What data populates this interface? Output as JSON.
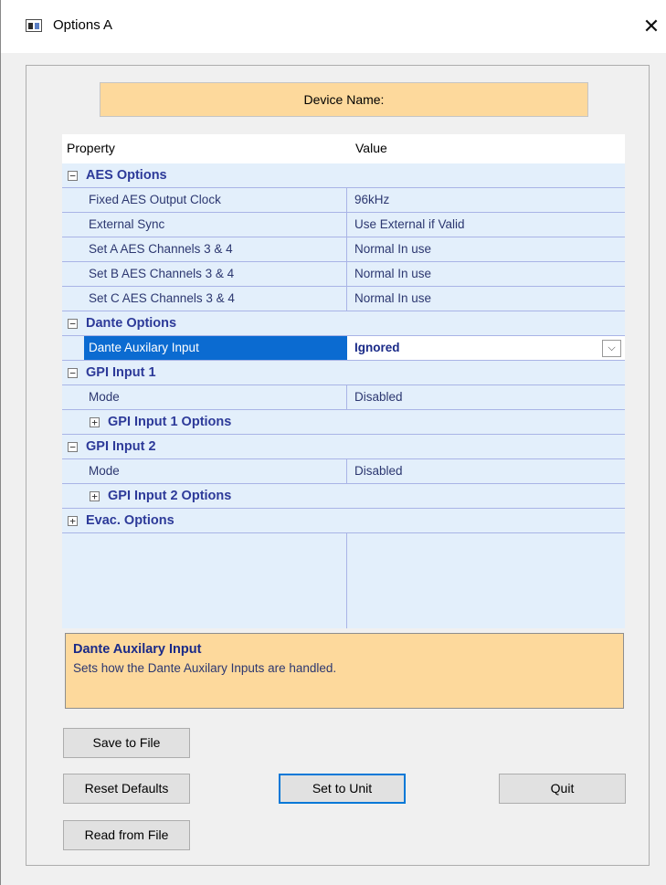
{
  "window": {
    "title": "Options A",
    "close_glyph": "✕"
  },
  "device": {
    "label": "Device Name:"
  },
  "grid": {
    "headers": {
      "property": "Property",
      "value": "Value"
    },
    "aes": {
      "category": "AES Options",
      "rows": [
        {
          "name": "Fixed AES Output Clock",
          "value": "96kHz"
        },
        {
          "name": "External Sync",
          "value": "Use External if Valid"
        },
        {
          "name": "Set A AES Channels 3 & 4",
          "value": "Normal In use"
        },
        {
          "name": "Set B AES Channels 3 & 4",
          "value": "Normal In use"
        },
        {
          "name": "Set C AES Channels 3 & 4",
          "value": "Normal In use"
        }
      ]
    },
    "dante": {
      "category": "Dante Options",
      "selected_row": {
        "name": "Dante Auxilary Input",
        "value": "Ignored"
      }
    },
    "gpi1": {
      "category": "GPI Input 1",
      "mode_name": "Mode",
      "mode_value": "Disabled",
      "sub": "GPI Input 1 Options"
    },
    "gpi2": {
      "category": "GPI Input 2",
      "mode_name": "Mode",
      "mode_value": "Disabled",
      "sub": "GPI Input 2 Options"
    },
    "evac": {
      "category": "Evac. Options"
    },
    "expander": {
      "collapse": "−",
      "expand": "+"
    },
    "dropdown_glyph": "⌵"
  },
  "help": {
    "title": "Dante Auxilary Input",
    "description": "Sets how the Dante Auxilary Inputs are handled."
  },
  "buttons": {
    "save": "Save to File",
    "reset": "Reset Defaults",
    "set": "Set to Unit",
    "quit": "Quit",
    "read": "Read from File"
  },
  "colors": {
    "grid_background": "#e3effb",
    "highlight_panel": "#fdd99c",
    "selection": "#0b6bd1",
    "category_text": "#2d3a99",
    "focus_border": "#0078d7"
  }
}
